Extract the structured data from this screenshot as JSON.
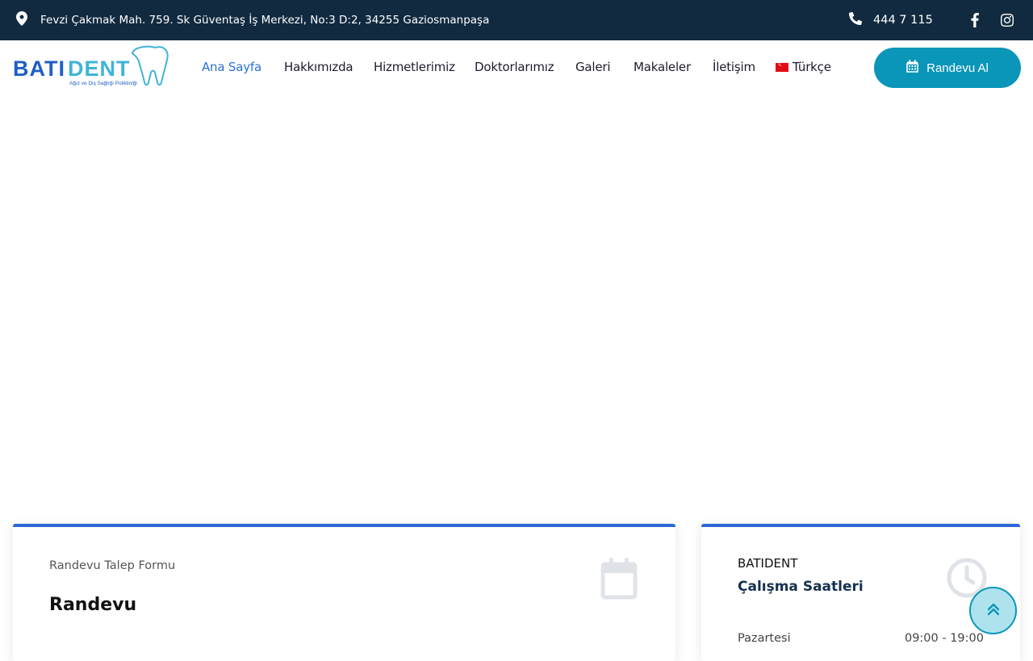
{
  "topbar": {
    "address": "Fevzi Çakmak Mah. 759. Sk Güventaş İş Merkezi, No:3 D:2, 34255 Gaziosmanpaşa",
    "phone": "444 7 115",
    "address_icon": "map-marker-icon",
    "phone_icon": "phone-icon",
    "social": [
      "facebook-icon",
      "instagram-icon"
    ]
  },
  "logo": {
    "wordmark": "BATIDENT",
    "tagline": "Ağız ve Diş Sağlığı Polikliniği"
  },
  "nav": {
    "items": [
      "Ana Sayfa",
      "Hakkımızda",
      "Hizmetlerimiz",
      "Doktorlarımız",
      "Galeri",
      "Makaleler",
      "İletişim"
    ],
    "language": "Türkçe",
    "active_index": 0,
    "cta": "Randevu Al"
  },
  "appointment_card": {
    "subtitle": "Randevu Talep Formu",
    "title": "Randevu",
    "icon": "calendar-icon"
  },
  "hours_card": {
    "brand": "BATIDENT",
    "title": "Çalışma Saatleri",
    "icon": "clock-icon",
    "rows": [
      {
        "day": "Pazartesi",
        "time": "09:00 - 19:00"
      }
    ]
  },
  "colors": {
    "topbar_bg": "#112a40",
    "accent": "#0a96b8",
    "nav_active": "#2a70d6",
    "card_border": "#2d68d8"
  }
}
